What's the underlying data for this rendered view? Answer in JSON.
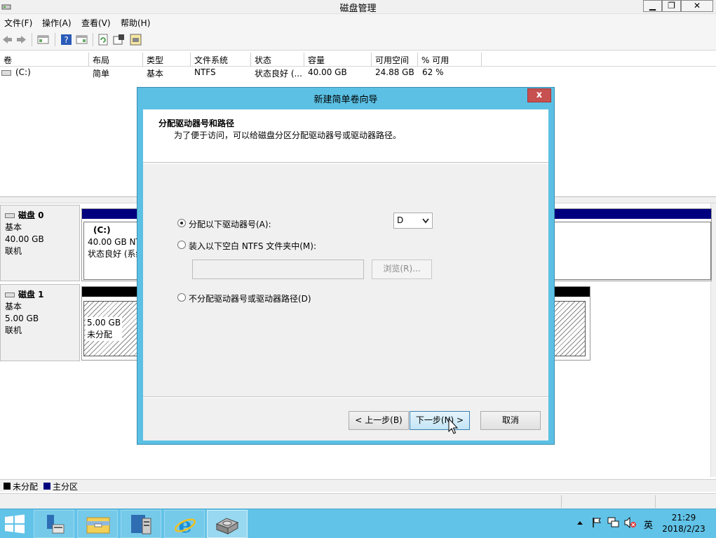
{
  "window": {
    "title": "磁盘管理",
    "minimize": "▁",
    "restore": "❐",
    "close": "✕"
  },
  "menu": [
    "文件(F)",
    "操作(A)",
    "查看(V)",
    "帮助(H)"
  ],
  "toolbar_icons": [
    "back-icon",
    "forward-icon",
    "show-hide-console-tree-icon",
    "help-icon",
    "show-hide-action-pane-icon",
    "refresh-icon",
    "properties-icon",
    "disk-management-icon"
  ],
  "table": {
    "columns": [
      "卷",
      "布局",
      "类型",
      "文件系统",
      "状态",
      "容量",
      "可用空间",
      "% 可用"
    ],
    "rows": [
      [
        "(C:)",
        "简单",
        "基本",
        "NTFS",
        "状态良好 (...",
        "40.00 GB",
        "24.88 GB",
        "62 %"
      ]
    ]
  },
  "disks": [
    {
      "name": "磁盘 0",
      "type": "基本",
      "size": "40.00 GB",
      "status": "联机",
      "partition": {
        "label": "(C:)",
        "line1": "40.00 GB NT",
        "line2": "状态良好 (系统"
      }
    },
    {
      "name": "磁盘 1",
      "type": "基本",
      "size": "5.00 GB",
      "status": "联机",
      "partition": {
        "line1": "5.00 GB",
        "line2": "未分配"
      }
    }
  ],
  "legend": {
    "unallocated": "未分配",
    "primary": "主分区",
    "unallocated_color": "#000000",
    "primary_color": "#00007f"
  },
  "dialog": {
    "title": "新建简单卷向导",
    "close": "x",
    "heading": "分配驱动器号和路径",
    "subheading": "为了便于访问，可以给磁盘分区分配驱动器号或驱动器路径。",
    "option_assign": "分配以下驱动器号(A):",
    "drive_letter": "D",
    "option_mount": "装入以下空白 NTFS 文件夹中(M):",
    "folder_path": "",
    "browse": "浏览(R)...",
    "option_none": "不分配驱动器号或驱动器路径(D)",
    "back": "< 上一步(B)",
    "next": "下一步(N) >",
    "cancel": "取消",
    "selected_option": "assign"
  },
  "taskbar": {
    "apps": [
      "server-manager-icon",
      "file-explorer-icon",
      "powershell-icon",
      "internet-explorer-icon",
      "disk-management-icon"
    ],
    "ime": "英",
    "time": "21:29",
    "date": "2018/2/23"
  }
}
